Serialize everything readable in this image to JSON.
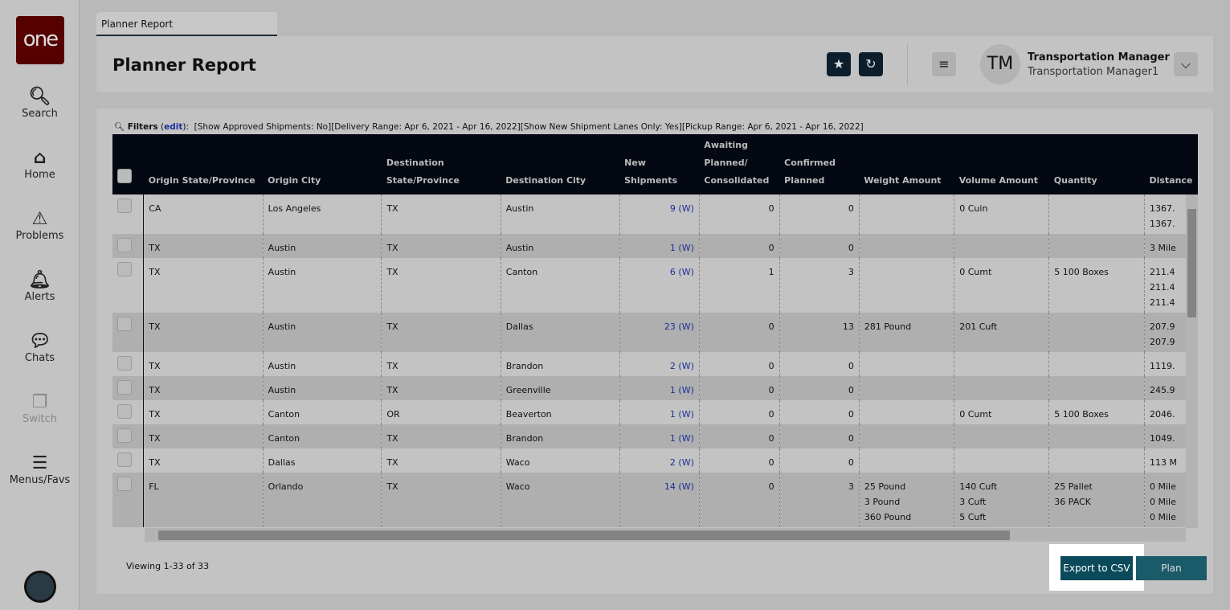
{
  "sidebar": {
    "logo": "one",
    "items": [
      {
        "label": "Search",
        "icon": "search-icon"
      },
      {
        "label": "Home",
        "icon": "home-icon"
      },
      {
        "label": "Problems",
        "icon": "warning-icon"
      },
      {
        "label": "Alerts",
        "icon": "bell-icon"
      },
      {
        "label": "Chats",
        "icon": "chat-icon"
      },
      {
        "label": "Switch",
        "icon": "switch-icon"
      },
      {
        "label": "Menus/Favs",
        "icon": "menu-icon"
      }
    ]
  },
  "tab": {
    "label": "Planner Report"
  },
  "header": {
    "title": "Planner Report",
    "user_initials": "TM",
    "user_name": "Transportation Manager",
    "user_role": "Transportation Manager1"
  },
  "filters": {
    "label": "Filters",
    "edit": "edit",
    "text": "[Show Approved Shipments: No][Delivery Range: Apr 6, 2021 - Apr 16, 2022][Show New Shipment Lanes Only: Yes][Pickup Range: Apr 6, 2021 - Apr 16, 2022]"
  },
  "table": {
    "columns": [
      "Origin State/Province",
      "Origin City",
      "Destination State/Province",
      "Destination City",
      "New Shipments",
      "Awaiting Planned/ Consolidated",
      "Confirmed Planned",
      "Weight Amount",
      "Volume Amount",
      "Quantity",
      "Distance"
    ],
    "rows": [
      [
        "CA",
        "Los Angeles",
        "TX",
        "Austin",
        "9 (W)",
        "0",
        "0",
        [],
        [
          "0 Cuin"
        ],
        [],
        [
          "1367.",
          "1367."
        ]
      ],
      [
        "TX",
        "Austin",
        "TX",
        "Austin",
        "1 (W)",
        "0",
        "0",
        [],
        [],
        [],
        [
          "3 Mile"
        ]
      ],
      [
        "TX",
        "Austin",
        "TX",
        "Canton",
        "6 (W)",
        "1",
        "3",
        [],
        [
          "0 Cumt"
        ],
        [
          "5 100 Boxes"
        ],
        [
          "211.4",
          "211.4",
          "211.4"
        ]
      ],
      [
        "TX",
        "Austin",
        "TX",
        "Dallas",
        "23 (W)",
        "0",
        "13",
        [
          "281 Pound"
        ],
        [
          "201 Cuft"
        ],
        [],
        [
          "207.9",
          "207.9"
        ]
      ],
      [
        "TX",
        "Austin",
        "TX",
        "Brandon",
        "2 (W)",
        "0",
        "0",
        [],
        [],
        [],
        [
          "1119."
        ]
      ],
      [
        "TX",
        "Austin",
        "TX",
        "Greenville",
        "1 (W)",
        "0",
        "0",
        [],
        [],
        [],
        [
          "245.9"
        ]
      ],
      [
        "TX",
        "Canton",
        "OR",
        "Beaverton",
        "1 (W)",
        "0",
        "0",
        [],
        [
          "0 Cumt"
        ],
        [
          "5 100 Boxes"
        ],
        [
          "2046."
        ]
      ],
      [
        "TX",
        "Canton",
        "TX",
        "Brandon",
        "1 (W)",
        "0",
        "0",
        [],
        [],
        [],
        [
          "1049."
        ]
      ],
      [
        "TX",
        "Dallas",
        "TX",
        "Waco",
        "2 (W)",
        "0",
        "0",
        [],
        [],
        [],
        [
          "113 M"
        ]
      ],
      [
        "FL",
        "Orlando",
        "TX",
        "Waco",
        "14 (W)",
        "0",
        "3",
        [
          "25 Pound",
          "3 Pound",
          "360 Pound"
        ],
        [
          "140 Cuft",
          "3 Cuft",
          "5 Cuft"
        ],
        [
          "25 Pallet",
          "36 PACK"
        ],
        [
          "0 Mile",
          "0 Mile",
          "0 Mile"
        ]
      ]
    ]
  },
  "footer": {
    "viewing": "Viewing 1-33 of 33",
    "export": "Export to CSV",
    "plan": "Plan"
  },
  "colors": {
    "brand": "#560000",
    "header": "#040812",
    "button": "#0b4a5a",
    "link": "#1a2f9a"
  }
}
